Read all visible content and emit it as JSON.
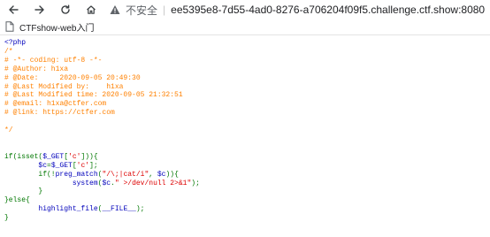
{
  "browser": {
    "security_label": "不安全",
    "separator": "|",
    "url": "ee5395e8-7d55-4ad0-8276-a706204f09f5.challenge.ctf.show:8080",
    "bookmarks": [
      {
        "label": "CTFshow-web入门"
      }
    ]
  },
  "colors": {
    "default": "#0000bb",
    "comment": "#ff8000",
    "keyword": "#007700",
    "string": "#dd0000"
  },
  "source": {
    "open_tag": "<?php",
    "comments": [
      "/*",
      "# -*- coding: utf-8 -*-",
      "# @Author: h1xa",
      "# @Date:     2020-09-05 20:49:30",
      "# @Last Modified by:    h1xa",
      "# @Last Modified time: 2020-09-05 21:32:51",
      "# @email: h1xa@ctfer.com",
      "# @link: https://ctfer.com",
      "",
      "*/"
    ],
    "line_if": {
      "kw_if": "if(isset(",
      "var_get": "$_GET",
      "bracket_open": "[",
      "str_c": "'c'",
      "tail": "])){"
    },
    "line_assign": {
      "var_c": "$c",
      "eq": "=",
      "var_get": "$_GET",
      "bracket_open": "[",
      "str_c": "'c'",
      "tail": "];"
    },
    "line_match": {
      "kw": "if(!",
      "fn": "preg_match",
      "paren": "(",
      "pattern": "\"/\\;|cat/i\"",
      "comma": ", ",
      "var_c": "$c",
      "tail": ")){"
    },
    "line_system": {
      "fn": "system",
      "paren": "(",
      "var_c": "$c",
      "dot": ".",
      "str": "\" >/dev/null 2>&1\"",
      "tail": ");"
    },
    "line_close_inner": "}",
    "line_else": "}else{",
    "line_highlight": {
      "fn": "highlight_file",
      "paren": "(",
      "const": "__FILE__",
      "tail": ");"
    },
    "line_close_outer": "}"
  }
}
